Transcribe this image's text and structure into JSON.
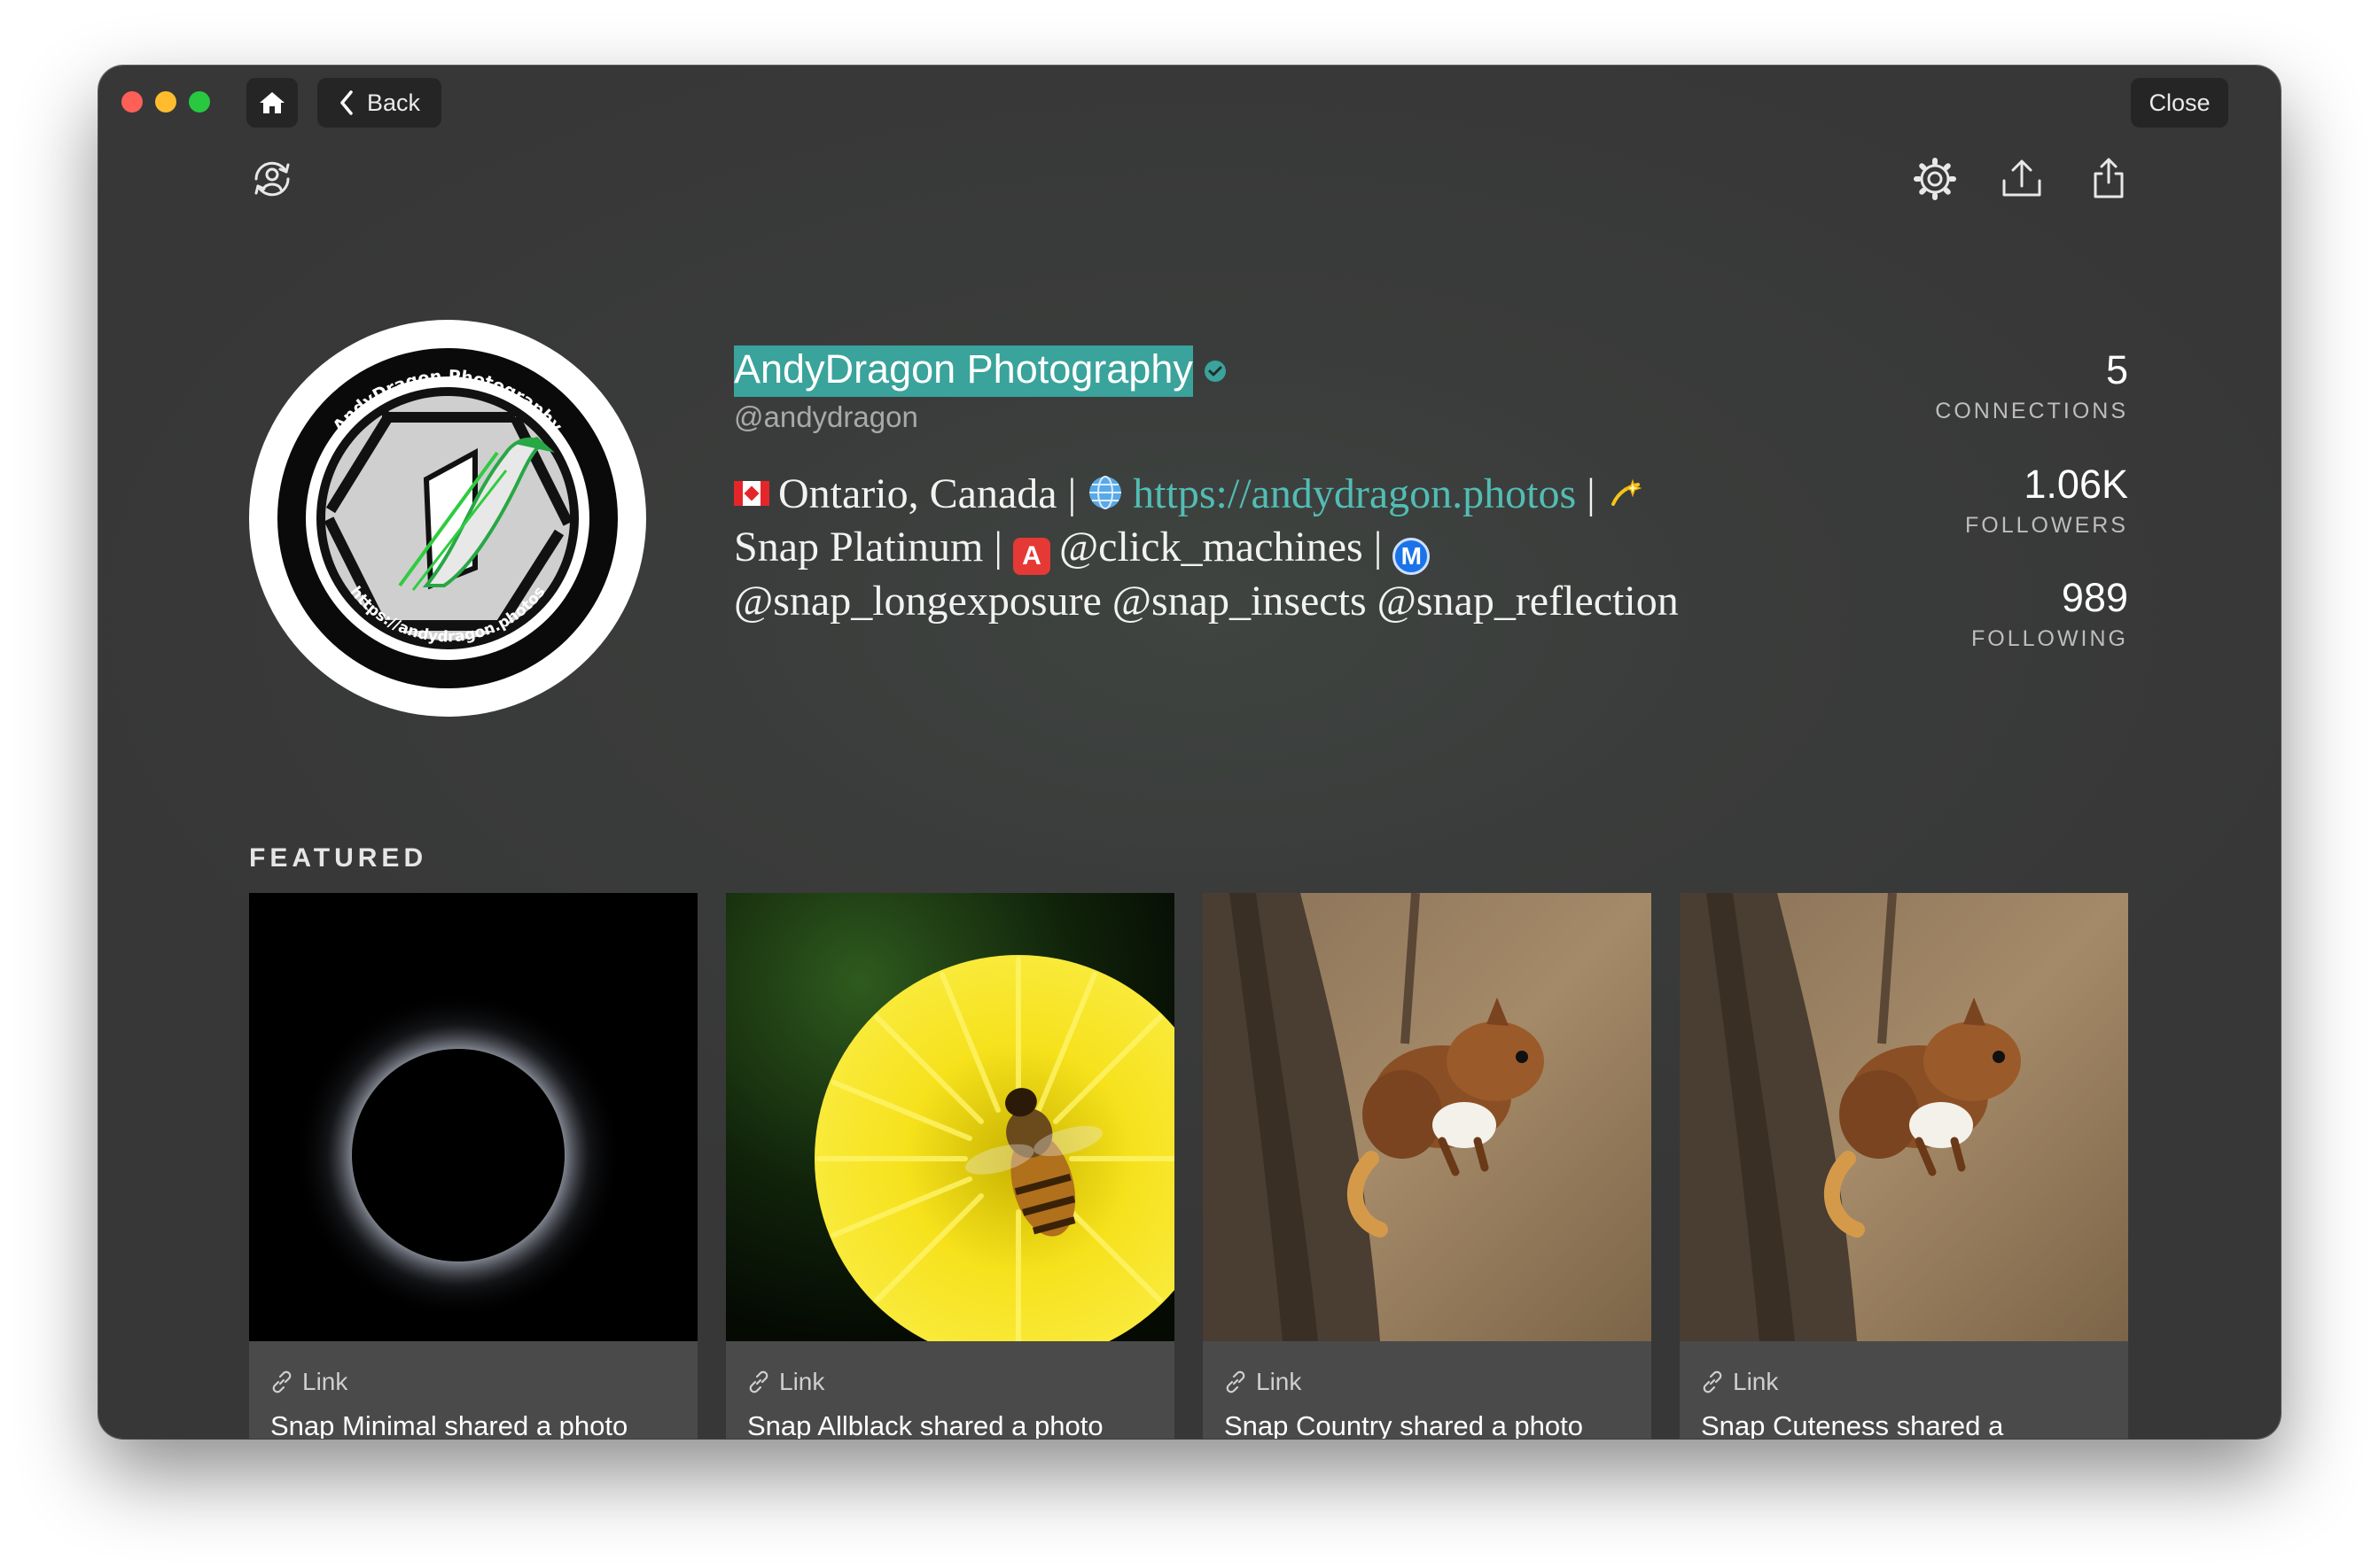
{
  "window": {
    "home_label": "Home",
    "back_label": "Back",
    "close_label": "Close"
  },
  "toolbar": {
    "icons": [
      "profile-sync-icon",
      "gear-icon",
      "upload-icon",
      "share-icon"
    ]
  },
  "profile": {
    "name": "AndyDragon Photography",
    "handle": "@andydragon",
    "avatar_text_top": "AndyDragon Photography",
    "avatar_text_bottom": "https://andydragon.photos",
    "bio": {
      "line1_location": "Ontario, Canada",
      "sep": "|",
      "link": "https://andydragon.photos",
      "line2_text": "Snap Platinum",
      "mention1": "@click_machines",
      "mention2": "@snap_longexposure",
      "mention3": "@snap_insects",
      "mention4": "@snap_reflection",
      "emoji_a": "A",
      "emoji_m": "M"
    },
    "accent_color": "#3aa39b"
  },
  "stats": [
    {
      "value": "5",
      "label": "CONNECTIONS"
    },
    {
      "value": "1.06K",
      "label": "FOLLOWERS"
    },
    {
      "value": "989",
      "label": "FOLLOWING"
    }
  ],
  "featured": {
    "heading": "FEATURED",
    "cards": [
      {
        "type": "Link",
        "title": "Snap Minimal shared a photo",
        "image": "solar-eclipse"
      },
      {
        "type": "Link",
        "title": "Snap Allblack shared a photo",
        "image": "bee-on-dandelion"
      },
      {
        "type": "Link",
        "title": "Snap Country shared a photo",
        "image": "squirrel-on-tree"
      },
      {
        "type": "Link",
        "title": "Snap Cuteness shared a",
        "image": "squirrel-on-tree"
      }
    ]
  }
}
